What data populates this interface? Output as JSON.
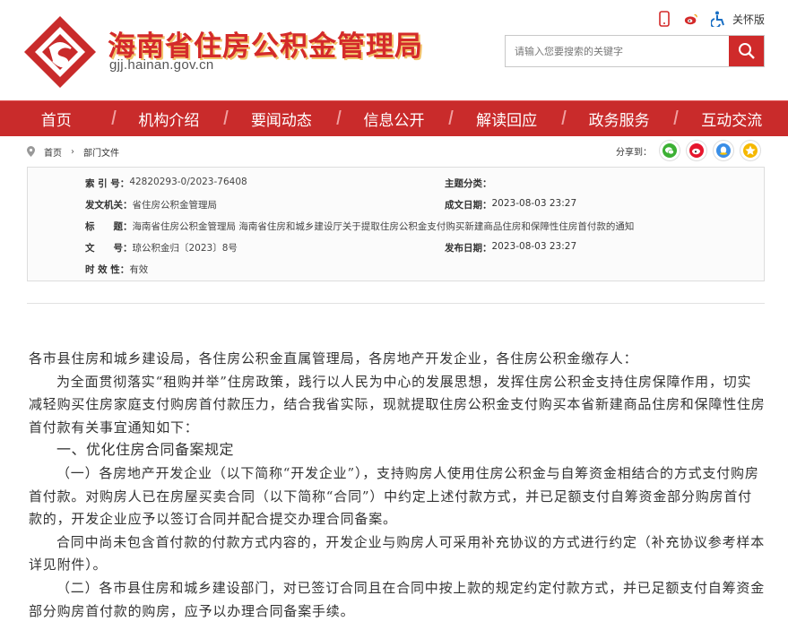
{
  "header": {
    "site_title": "海南省住房公积金管理局",
    "site_url": "gjj.hainan.gov.cn",
    "care_label": "关怀版",
    "search_placeholder": "请输入您要搜索的关键字",
    "icons": [
      "phone-icon",
      "weibo-icon",
      "accessibility-icon",
      "search-icon"
    ]
  },
  "nav": {
    "items": [
      "首页",
      "机构介绍",
      "要闻动态",
      "信息公开",
      "解读回应",
      "政务服务",
      "互动交流"
    ]
  },
  "breadcrumb": {
    "home": "首页",
    "sep": "›",
    "current": "部门文件"
  },
  "share": {
    "label": "分享到：",
    "icons": [
      "wechat-icon",
      "weibo-icon",
      "qq-icon",
      "qzone-icon"
    ]
  },
  "meta": {
    "index_label": "索 引 号：",
    "index_value": "42820293-0/2023-76408",
    "topic_label": "主题分类：",
    "topic_value": "",
    "issuer_label": "发文机关：",
    "issuer_value": "省住房公积金管理局",
    "date_label": "成文日期：",
    "date_value": "2023-08-03 23:27",
    "title_label": "标　　题：",
    "title_value": "海南省住房公积金管理局 海南省住房和城乡建设厅关于提取住房公积金支付购买新建商品住房和保障性住房首付款的通知",
    "doc_label": "文　　号：",
    "doc_value": "琼公积金归〔2023〕8号",
    "pub_label": "发布日期：",
    "pub_value": "2023-08-03 23:27",
    "validity_label": "时 效 性：",
    "validity_value": "有效"
  },
  "article": {
    "addressees": "各市县住房和城乡建设局，各住房公积金直属管理局，各房地产开发企业，各住房公积金缴存人：",
    "p1": "为全面贯彻落实“租购并举”住房政策，践行以人民为中心的发展思想，发挥住房公积金支持住房保障作用，切实减轻购买住房家庭支付购房首付款压力，结合我省实际，现就提取住房公积金支付购买本省新建商品住房和保障性住房首付款有关事宜通知如下：",
    "h1": "一、优化住房合同备案规定",
    "p2": "（一）各房地产开发企业（以下简称“开发企业”），支持购房人使用住房公积金与自筹资金相结合的方式支付购房首付款。对购房人已在房屋买卖合同（以下简称“合同”）中约定上述付款方式，并已足额支付自筹资金部分购房首付款的，开发企业应予以签订合同并配合提交办理合同备案。",
    "p3": "合同中尚未包含首付款的付款方式内容的，开发企业与购房人可采用补充协议的方式进行约定（补充协议参考样本详见附件）。",
    "p4": "（二）各市县住房和城乡建设部门，对已签订合同且在合同中按上款的规定约定付款方式，并已足额支付自筹资金部分购房首付款的购房，应予以办理合同备案手续。"
  },
  "colors": {
    "brand_red": "#c92b2b",
    "title_red": "#d42a2a"
  }
}
